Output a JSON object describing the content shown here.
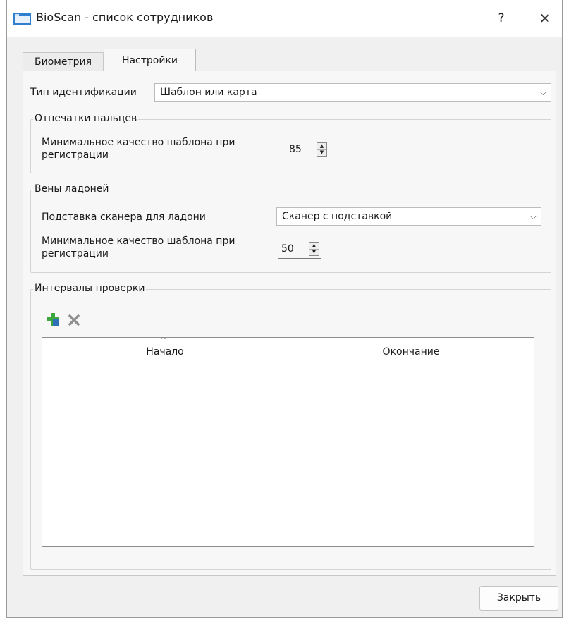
{
  "window": {
    "title": "BioScan - список сотрудников",
    "help_label": "?",
    "close_label": "✕"
  },
  "tabs": [
    {
      "label": "Биометрия",
      "active": false
    },
    {
      "label": "Настройки",
      "active": true
    }
  ],
  "settings": {
    "id_type_label": "Тип идентификации",
    "id_type_value": "Шаблон или карта"
  },
  "fingerprints": {
    "title": "Отпечатки пальцев",
    "min_quality_label_line1": "Минимальное качество шаблона при",
    "min_quality_label_line2": "регистрации",
    "min_quality_value": "85"
  },
  "palm_veins": {
    "title": "Вены ладоней",
    "stand_label": "Подставка сканера для ладони",
    "stand_value": "Сканер с подставкой",
    "min_quality_label_line1": "Минимальное качество шаблона при",
    "min_quality_label_line2": "регистрации",
    "min_quality_value": "50"
  },
  "intervals": {
    "title": "Интервалы проверки",
    "columns": [
      "Начало",
      "Окончание"
    ],
    "rows": []
  },
  "footer": {
    "close_button": "Закрыть"
  },
  "icons": {
    "app": "app-window-icon",
    "add": "add-plus-icon",
    "delete": "delete-x-icon"
  },
  "colors": {
    "add_icon_green": "#3ea63e",
    "add_icon_blue": "#2f6fb5",
    "app_icon_blue": "#2e7fd0"
  }
}
